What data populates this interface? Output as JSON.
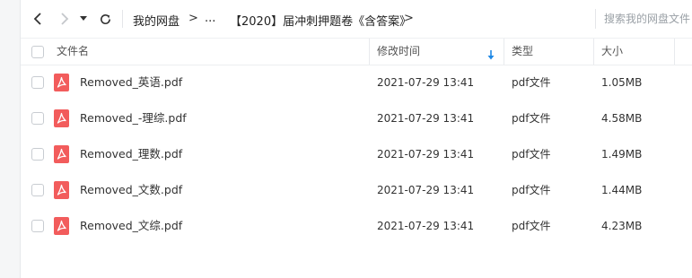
{
  "breadcrumb": {
    "root": "我的网盘",
    "ellipsis": "...",
    "folder": "【2020】届冲刺押题卷《含答案》",
    "separator": ">"
  },
  "search": {
    "placeholder": "搜索我的网盘文件"
  },
  "columns": {
    "name": "文件名",
    "modified": "修改时间",
    "type": "类型",
    "size": "大小"
  },
  "files": [
    {
      "name": "Removed_英语.pdf",
      "modified": "2021-07-29 13:41",
      "type": "pdf文件",
      "size": "1.05MB"
    },
    {
      "name": "Removed_-理综.pdf",
      "modified": "2021-07-29 13:41",
      "type": "pdf文件",
      "size": "4.58MB"
    },
    {
      "name": "Removed_理数.pdf",
      "modified": "2021-07-29 13:41",
      "type": "pdf文件",
      "size": "1.49MB"
    },
    {
      "name": "Removed_文数.pdf",
      "modified": "2021-07-29 13:41",
      "type": "pdf文件",
      "size": "1.44MB"
    },
    {
      "name": "Removed_文综.pdf",
      "modified": "2021-07-29 13:41",
      "type": "pdf文件",
      "size": "4.23MB"
    }
  ],
  "colors": {
    "accent": "#1e88e5",
    "pdf_icon": "#f25c5c",
    "text": "#333333"
  }
}
